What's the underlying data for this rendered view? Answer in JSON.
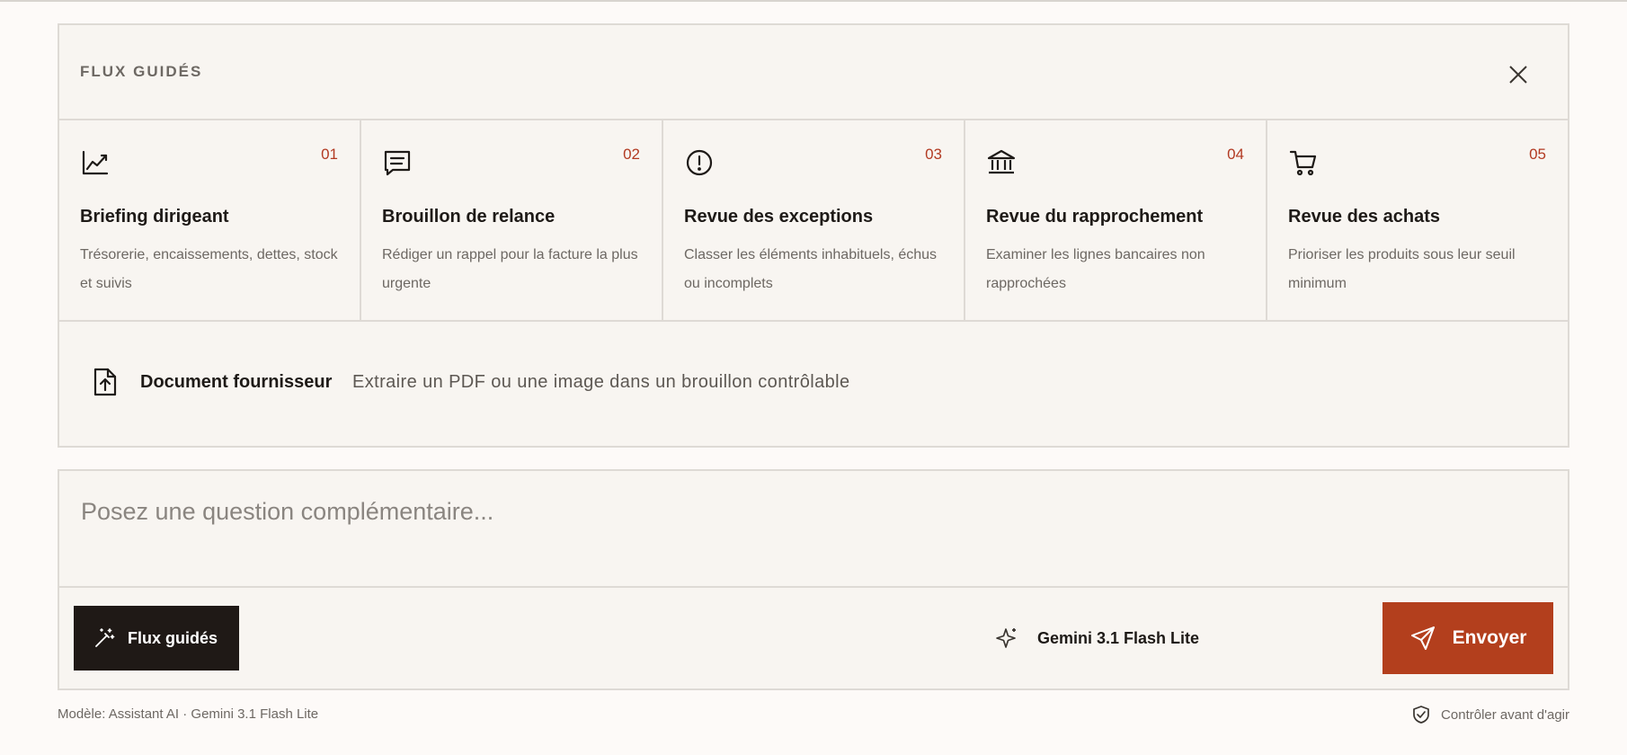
{
  "panel": {
    "title": "FLUX GUIDÉS",
    "close_icon": "close-icon",
    "cards": [
      {
        "num": "01",
        "icon": "chart-line-icon",
        "title": "Briefing dirigeant",
        "desc": "Trésorerie, encaissements, dettes, stock et suivis"
      },
      {
        "num": "02",
        "icon": "message-icon",
        "title": "Brouillon de relance",
        "desc": "Rédiger un rappel pour la facture la plus urgente"
      },
      {
        "num": "03",
        "icon": "alert-circle-icon",
        "title": "Revue des exceptions",
        "desc": "Classer les éléments inhabituels, échus ou incomplets"
      },
      {
        "num": "04",
        "icon": "bank-icon",
        "title": "Revue du rapprochement",
        "desc": "Examiner les lignes bancaires non rapprochées"
      },
      {
        "num": "05",
        "icon": "cart-icon",
        "title": "Revue des achats",
        "desc": "Prioriser les produits sous leur seuil minimum"
      }
    ],
    "document": {
      "icon": "file-upload-icon",
      "title": "Document fournisseur",
      "desc": "Extraire un PDF ou une image dans un brouillon contrôlable"
    }
  },
  "composer": {
    "placeholder": "Posez une question complémentaire...",
    "flux_label": "Flux guidés",
    "model_name": "Gemini 3.1 Flash Lite",
    "send_label": "Envoyer"
  },
  "footer": {
    "model_info": "Modèle: Assistant AI · Gemini 3.1 Flash Lite",
    "check_label": "Contrôler avant d'agir"
  },
  "colors": {
    "accent": "#b33f1d",
    "number": "#b23a22",
    "dark_button": "#1f1916"
  }
}
